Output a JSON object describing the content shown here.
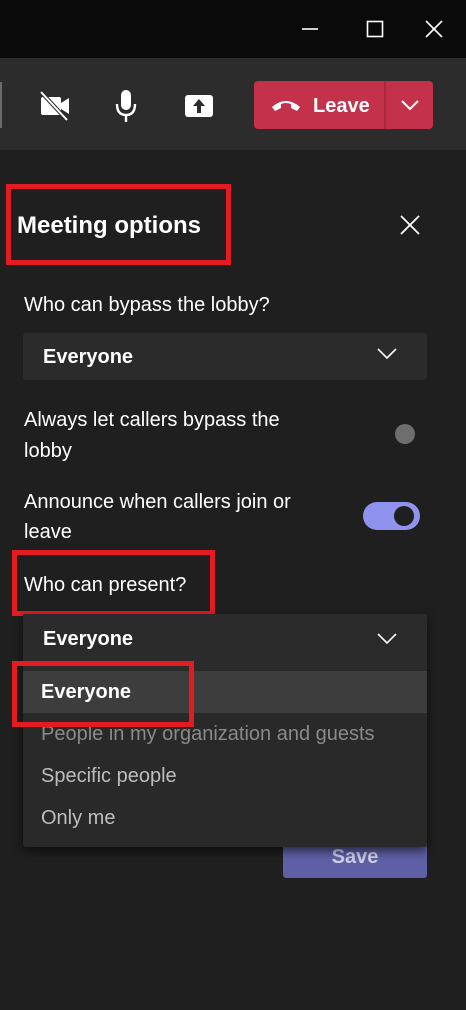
{
  "toolbar": {
    "leave_label": "Leave",
    "icons": [
      "camera-off-icon",
      "microphone-icon",
      "share-screen-icon",
      "phone-hangup-icon",
      "chevron-down-icon"
    ]
  },
  "panel": {
    "title": "Meeting options",
    "bypass_lobby": {
      "label": "Who can bypass the lobby?",
      "value": "Everyone"
    },
    "callers_bypass": {
      "label_line1": "Always let callers bypass the",
      "label_line2": "lobby",
      "enabled": false
    },
    "announce_callers": {
      "label_line1": "Announce when callers join or",
      "label_line2": "leave",
      "enabled": true
    },
    "presenters": {
      "label": "Who can present?",
      "value": "Everyone",
      "options": [
        "Everyone",
        "People in my organization and guests",
        "Specific people",
        "Only me"
      ],
      "selected_index": 0
    },
    "save_label": "Save"
  },
  "colors": {
    "accent": "#8f93ed",
    "leave": "#c4314b",
    "annotation": "#e31b23",
    "save": "#5f5fa6"
  }
}
